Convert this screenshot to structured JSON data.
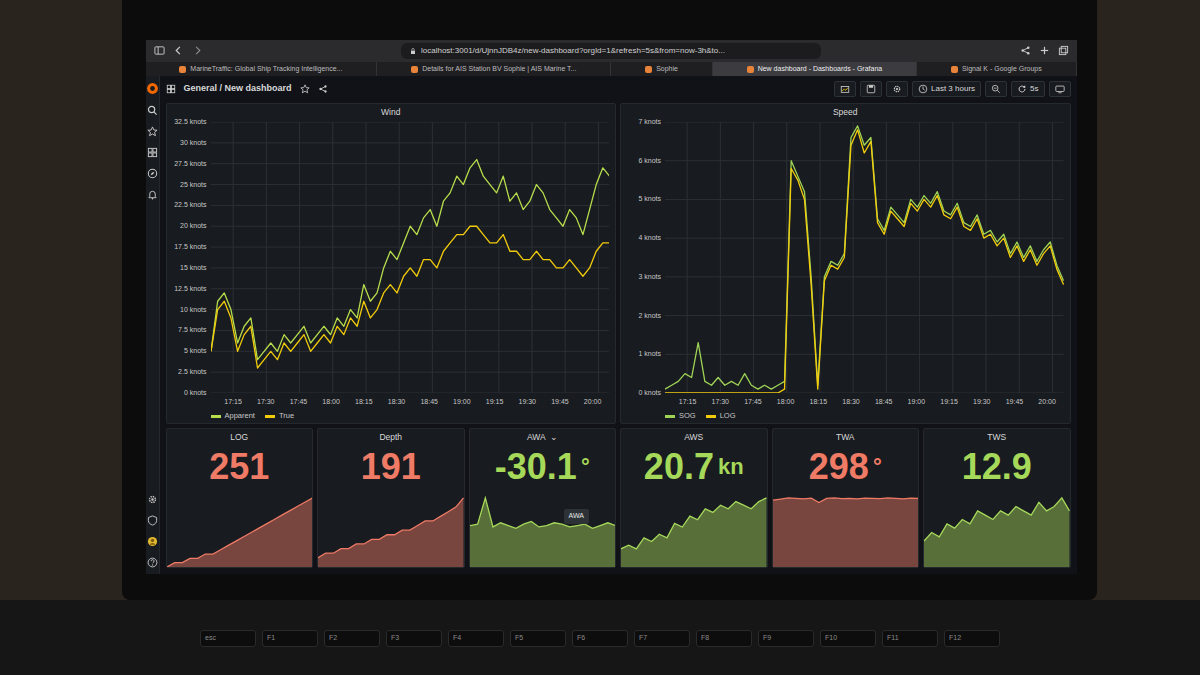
{
  "browser": {
    "url": "localhost:3001/d/UjnnJDB4z/new-dashboard?orgId=1&refresh=5s&from=now-3h&to...",
    "tabs": [
      {
        "label": "MarineTraffic: Global Ship Tracking Intelligence...",
        "selected": false
      },
      {
        "label": "Details for AIS Station BV Sophie | AIS Marine T...",
        "selected": false
      },
      {
        "label": "Sophie",
        "selected": false
      },
      {
        "label": "New dashboard - Dashboards - Grafana",
        "selected": true
      },
      {
        "label": "Signal K - Google Groups",
        "selected": false
      }
    ]
  },
  "grafana": {
    "breadcrumb": "General / New dashboard",
    "time_range": "Last 3 hours",
    "refresh": "5s"
  },
  "charts": [
    {
      "title": "Wind",
      "y_ticks": [
        "0 knots",
        "2.5 knots",
        "5 knots",
        "7.5 knots",
        "10 knots",
        "12.5 knots",
        "15 knots",
        "17.5 knots",
        "20 knots",
        "22.5 knots",
        "25 knots",
        "27.5 knots",
        "30 knots",
        "32.5 knots"
      ],
      "x_ticks": [
        "17:15",
        "17:30",
        "17:45",
        "18:00",
        "18:15",
        "18:30",
        "18:45",
        "19:00",
        "19:15",
        "19:30",
        "19:45",
        "20:00"
      ],
      "series": [
        {
          "name": "Apparent",
          "color": "#b7dd4c",
          "values": [
            5,
            11,
            12,
            10,
            6,
            8,
            9,
            4,
            5,
            6,
            5,
            7,
            6,
            7,
            8,
            6,
            7,
            8,
            7,
            9,
            8,
            10,
            9,
            13,
            11,
            12,
            15,
            17,
            16,
            18,
            20,
            19,
            21,
            22,
            20,
            23,
            24,
            26,
            25,
            27,
            28,
            26,
            25,
            24,
            26,
            23,
            24,
            22,
            23,
            25,
            24,
            22,
            21,
            20,
            22,
            21,
            19,
            22,
            25,
            27,
            26
          ]
        },
        {
          "name": "True",
          "color": "#f2cc0c",
          "values": [
            5,
            10,
            11,
            9,
            5,
            7,
            8,
            3,
            4,
            5,
            4,
            6,
            5,
            6,
            7,
            5,
            6,
            7,
            6,
            8,
            7,
            9,
            8,
            11,
            9,
            10,
            12,
            13,
            12,
            14,
            15,
            14,
            16,
            16,
            15,
            17,
            18,
            19,
            19,
            20,
            20,
            19,
            18,
            18,
            19,
            17,
            17,
            16,
            16,
            17,
            16,
            16,
            15,
            15,
            16,
            15,
            14,
            15,
            17,
            18,
            18
          ]
        }
      ]
    },
    {
      "title": "Speed",
      "y_ticks": [
        "0 knots",
        "1 knots",
        "2 knots",
        "3 knots",
        "4 knots",
        "5 knots",
        "6 knots",
        "7 knots"
      ],
      "x_ticks": [
        "17:15",
        "17:30",
        "17:45",
        "18:00",
        "18:15",
        "18:30",
        "18:45",
        "19:00",
        "19:15",
        "19:30",
        "19:45",
        "20:00"
      ],
      "series": [
        {
          "name": "SOG",
          "color": "#9fd356",
          "values": [
            0.1,
            0.2,
            0.3,
            0.5,
            0.4,
            1.3,
            0.3,
            0.2,
            0.4,
            0.2,
            0.3,
            0.2,
            0.5,
            0.2,
            0.1,
            0.2,
            0.1,
            0.2,
            0.3,
            6.0,
            5.6,
            5.2,
            3.0,
            0.2,
            3.0,
            3.4,
            3.3,
            3.6,
            6.6,
            6.9,
            6.4,
            6.6,
            4.5,
            4.2,
            4.8,
            4.6,
            4.4,
            5.0,
            4.8,
            5.1,
            4.9,
            5.2,
            4.7,
            4.6,
            4.9,
            4.4,
            4.3,
            4.6,
            4.1,
            4.2,
            3.9,
            4.1,
            3.6,
            3.9,
            3.5,
            3.8,
            3.4,
            3.7,
            3.9,
            3.3,
            2.9
          ]
        },
        {
          "name": "LOG",
          "color": "#f2cc0c",
          "values": [
            0,
            0,
            0,
            0,
            0,
            0,
            0,
            0,
            0,
            0,
            0,
            0,
            0,
            0,
            0,
            0,
            0,
            0,
            0.1,
            5.8,
            5.5,
            5.0,
            2.8,
            0.1,
            2.9,
            3.3,
            3.2,
            3.5,
            6.4,
            6.8,
            6.2,
            6.5,
            4.4,
            4.1,
            4.7,
            4.5,
            4.3,
            4.9,
            4.7,
            5.0,
            4.8,
            5.1,
            4.6,
            4.5,
            4.8,
            4.3,
            4.2,
            4.5,
            4.0,
            4.1,
            3.8,
            4.0,
            3.5,
            3.8,
            3.4,
            3.7,
            3.3,
            3.6,
            3.8,
            3.2,
            2.8
          ]
        }
      ]
    }
  ],
  "stats": [
    {
      "title": "LOG",
      "value": "251",
      "unit": "",
      "color": "#ef7b66",
      "spark": [
        0,
        1,
        1,
        2,
        2,
        3,
        3,
        4,
        5,
        6,
        7,
        8,
        9,
        10,
        11,
        12,
        13,
        14,
        15,
        16
      ]
    },
    {
      "title": "Depth",
      "value": "191",
      "unit": "",
      "color": "#ef7b66",
      "spark": [
        2,
        3,
        3,
        4,
        4,
        5,
        5,
        6,
        6,
        7,
        7,
        8,
        8,
        9,
        10,
        10,
        11,
        12,
        13,
        15
      ]
    },
    {
      "title": "AWA",
      "menu": "⌄",
      "tooltip": "AWA",
      "value": "-30.1",
      "unit": "°",
      "color": "#a6d85a",
      "spark": [
        30,
        31,
        50,
        29,
        32,
        30,
        28,
        31,
        33,
        29,
        30,
        32,
        31,
        29,
        30,
        31,
        28,
        30,
        32,
        30
      ]
    },
    {
      "title": "AWS",
      "value": "20.7",
      "unit": "kn",
      "color": "#a6d85a",
      "spark": [
        5,
        6,
        5,
        8,
        7,
        9,
        8,
        12,
        11,
        14,
        13,
        16,
        15,
        17,
        16,
        18,
        17,
        16,
        18,
        19
      ]
    },
    {
      "title": "TWA",
      "value": "298",
      "unit": "°",
      "color": "#ef7b66",
      "spark": [
        290,
        295,
        300,
        298,
        296,
        299,
        280,
        298,
        300,
        297,
        298,
        296,
        299,
        298,
        297,
        300,
        298,
        296,
        299,
        298
      ]
    },
    {
      "title": "TWS",
      "value": "12.9",
      "unit": "",
      "color": "#a6d85a",
      "spark": [
        6,
        8,
        7,
        10,
        9,
        11,
        10,
        13,
        12,
        11,
        13,
        12,
        14,
        13,
        12,
        15,
        13,
        14,
        16,
        13
      ]
    }
  ],
  "keyboard": [
    "esc",
    "F1",
    "F2",
    "F3",
    "F4",
    "F5",
    "F6",
    "F7",
    "F8",
    "F9",
    "F10",
    "F11",
    "F12"
  ]
}
